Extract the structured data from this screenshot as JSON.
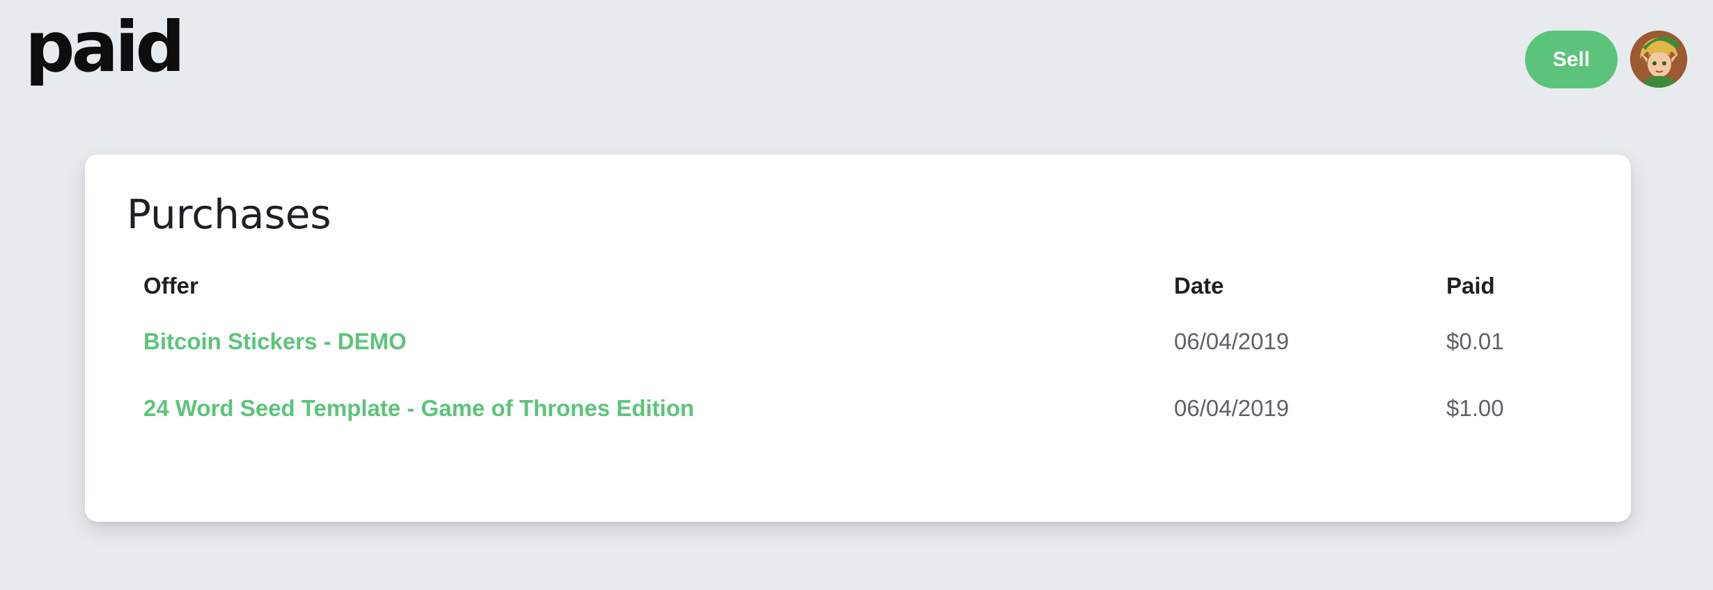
{
  "header": {
    "logo_text": "paid",
    "sell_label": "Sell",
    "avatar_icon": "user-avatar-icon"
  },
  "purchases": {
    "title": "Purchases",
    "columns": [
      "Offer",
      "Date",
      "Paid"
    ],
    "rows": [
      {
        "offer": "Bitcoin Stickers - DEMO",
        "date": "06/04/2019",
        "paid": "$0.01"
      },
      {
        "offer": "24 Word Seed Template - Game of Thrones Edition",
        "date": "06/04/2019",
        "paid": "$1.00"
      }
    ]
  },
  "colors": {
    "accent": "#5cc47a",
    "background": "#e8ebee",
    "card": "#ffffff",
    "text": "#1f1f24",
    "muted": "#5f6166"
  }
}
